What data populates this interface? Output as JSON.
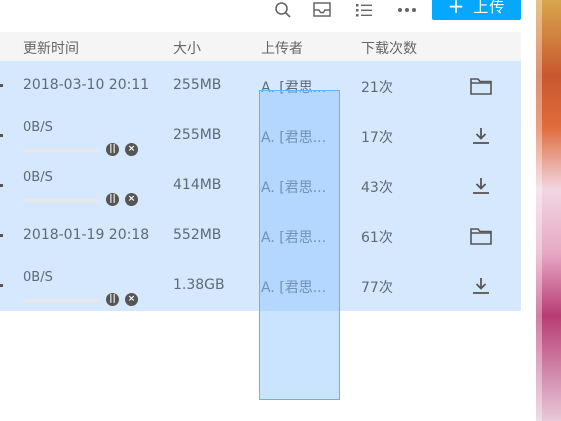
{
  "toolbar": {
    "icons": [
      "search-icon",
      "inbox-icon",
      "list-view-icon",
      "more-icon"
    ],
    "upload_label": "上传"
  },
  "columns": {
    "time": "更新时间",
    "size": "大小",
    "uploader": "上传者",
    "downloads": "下载次数"
  },
  "rows": [
    {
      "kind": "folder",
      "time": "2018-03-10 20:11",
      "size": "255MB",
      "uploader": "A. [君思...",
      "downloads": "21次"
    },
    {
      "kind": "download",
      "speed": "0B/S",
      "progress": 0,
      "size": "255MB",
      "uploader": "A. [君思...",
      "downloads": "17次"
    },
    {
      "kind": "download",
      "speed": "0B/S",
      "progress": 0,
      "size": "414MB",
      "uploader": "A. [君思...",
      "downloads": "43次"
    },
    {
      "kind": "folder",
      "time": "2018-01-19 20:18",
      "size": "552MB",
      "uploader": "A. [君思...",
      "downloads": "61次"
    },
    {
      "kind": "download",
      "speed": "0B/S",
      "progress": 0,
      "size": "1.38GB",
      "uploader": "A. [君思...",
      "downloads": "77次"
    }
  ],
  "colors": {
    "row_selected": "#d6e8fd",
    "accent": "#06a7ff",
    "selection_rect": "#89c4ff"
  }
}
